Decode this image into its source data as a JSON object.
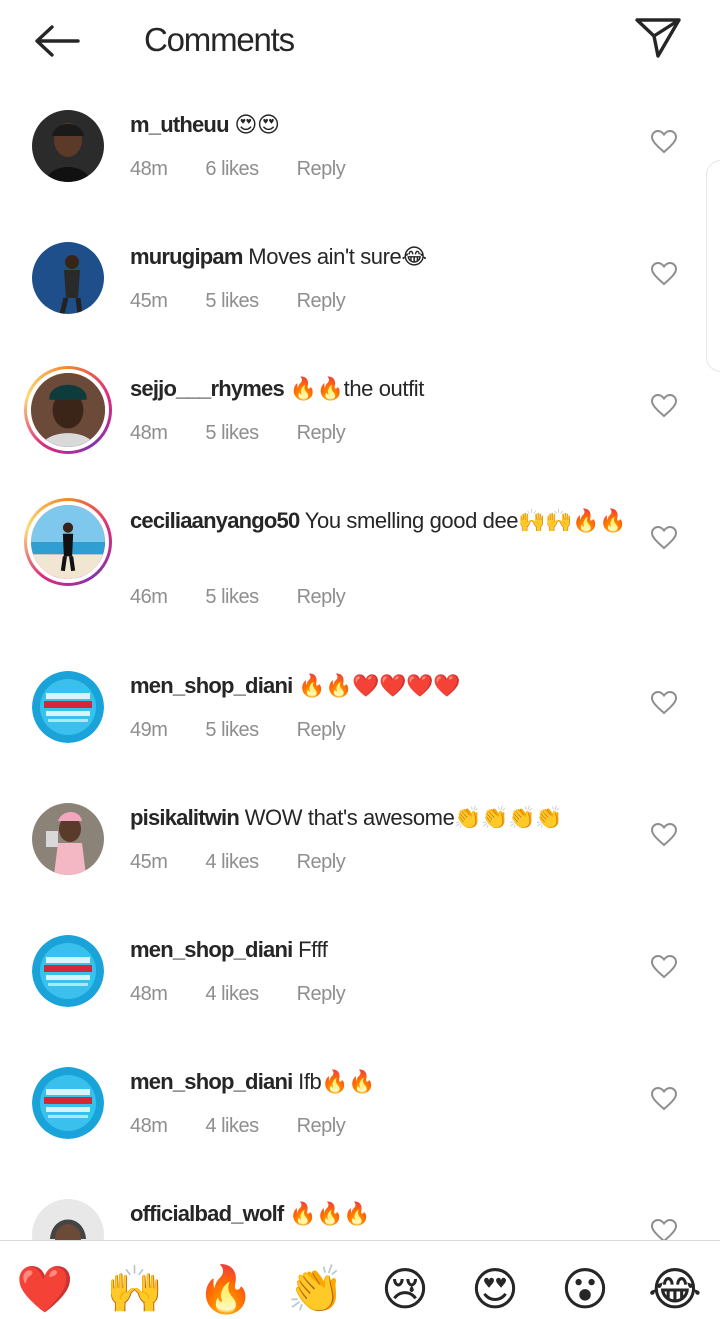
{
  "header": {
    "title": "Comments"
  },
  "icons": {
    "back": "back-arrow-icon",
    "share": "paper-plane-icon",
    "like": "heart-outline-icon"
  },
  "comments": [
    {
      "username": "m_utheuu",
      "text": " 😍😍",
      "time": "48m",
      "likes": "6 likes",
      "reply": "Reply"
    },
    {
      "username": "murugipam",
      "text": " Moves ain't sure😂",
      "time": "45m",
      "likes": "5 likes",
      "reply": "Reply"
    },
    {
      "username": "sejjo___rhymes",
      "text": " 🔥🔥the outfit",
      "time": "48m",
      "likes": "5 likes",
      "reply": "Reply"
    },
    {
      "username": "ceciliaanyango50",
      "text": " You smelling good dee🙌🙌🔥🔥",
      "time": "46m",
      "likes": "5 likes",
      "reply": "Reply"
    },
    {
      "username": "men_shop_diani",
      "text": " 🔥🔥❤️❤️❤️❤️",
      "time": "49m",
      "likes": "5 likes",
      "reply": "Reply"
    },
    {
      "username": "pisikalitwin",
      "text": " WOW that's awesome👏👏👏👏",
      "time": "45m",
      "likes": "4 likes",
      "reply": "Reply"
    },
    {
      "username": "men_shop_diani",
      "text": " Ffff",
      "time": "48m",
      "likes": "4 likes",
      "reply": "Reply"
    },
    {
      "username": "men_shop_diani",
      "text": " Ifb🔥🔥",
      "time": "48m",
      "likes": "4 likes",
      "reply": "Reply"
    },
    {
      "username": "officialbad_wolf",
      "text": " 🔥🔥🔥",
      "time": "",
      "likes": "",
      "reply": ""
    }
  ],
  "reactions": [
    "❤️",
    "🙌",
    "🔥",
    "👏",
    "😢",
    "😍",
    "😮",
    "😂"
  ],
  "colors": {
    "text": "#262626",
    "meta": "#8e8e8e",
    "divider": "#dbdbdb",
    "story_ring": [
      "#f58529",
      "#dd2a7b",
      "#8134af",
      "#feda75"
    ],
    "shop_avatar": "#1aa3d9"
  }
}
